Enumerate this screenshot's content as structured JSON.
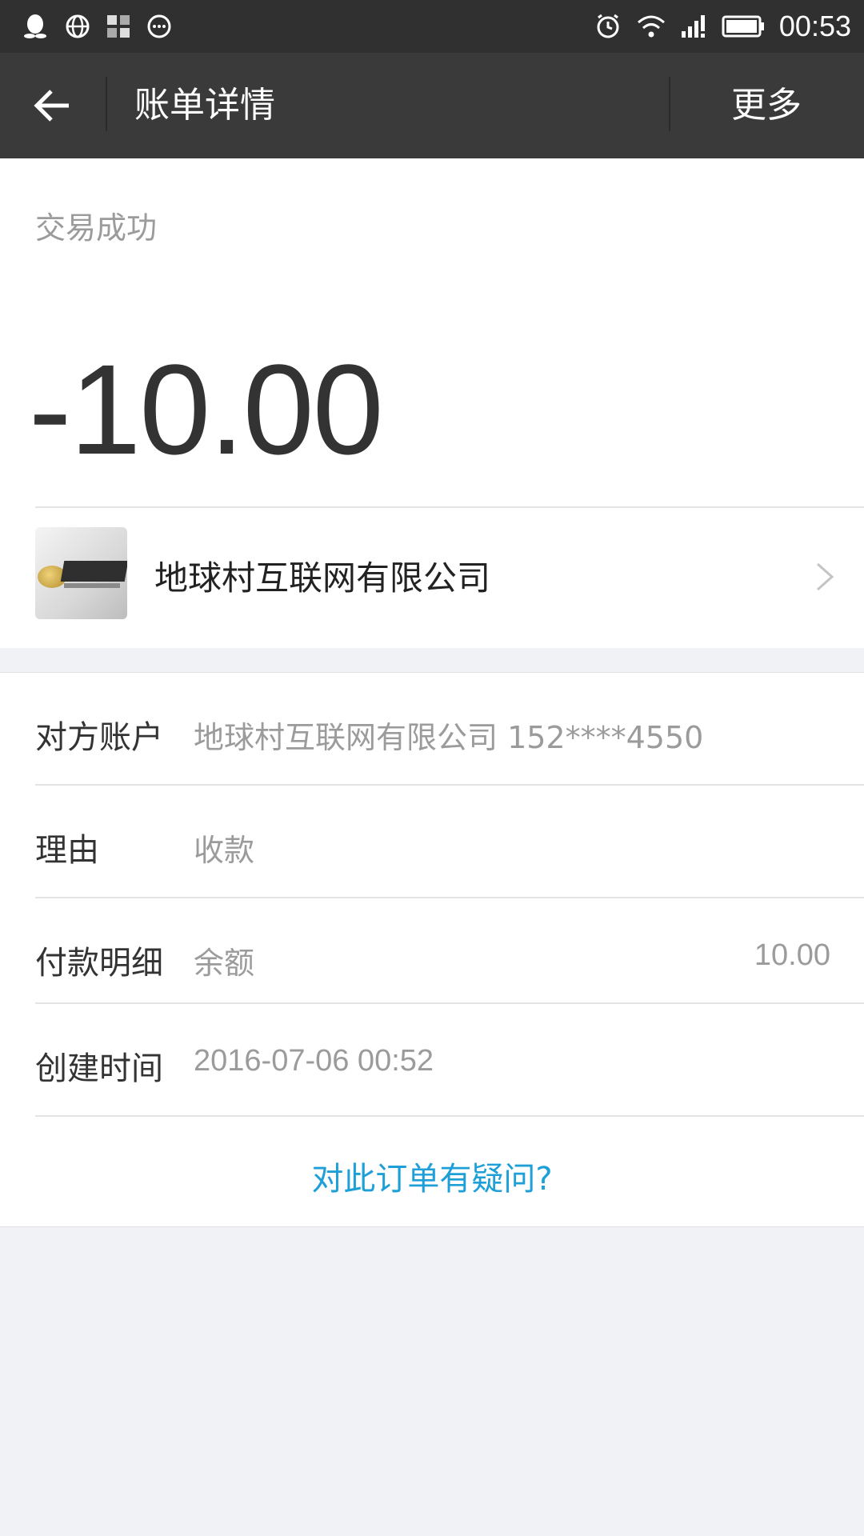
{
  "status_bar": {
    "time": "00:53",
    "left_icons": [
      "qq-icon",
      "globe-icon",
      "apps-grid-icon",
      "chat-bubble-icon"
    ],
    "right_icons": [
      "alarm-icon",
      "wifi-icon",
      "signal-icon",
      "battery-icon"
    ]
  },
  "header": {
    "title": "账单详情",
    "more_label": "更多"
  },
  "summary": {
    "status": "交易成功",
    "amount": "-10.00",
    "merchant_name": "地球村互联网有限公司"
  },
  "details": {
    "rows": [
      {
        "label": "对方账户",
        "value": "地球村互联网有限公司 152****4550"
      },
      {
        "label": "理由",
        "value": "收款"
      },
      {
        "label": "付款明细",
        "value": "余额",
        "amount": "10.00"
      },
      {
        "label": "创建时间",
        "value": "2016-07-06 00:52"
      }
    ],
    "help_link": "对此订单有疑问?"
  },
  "colors": {
    "status_bar_bg": "#303030",
    "title_bar_bg": "#3a3a3a",
    "page_bg": "#f1f2f6",
    "link": "#1e9fd8"
  }
}
